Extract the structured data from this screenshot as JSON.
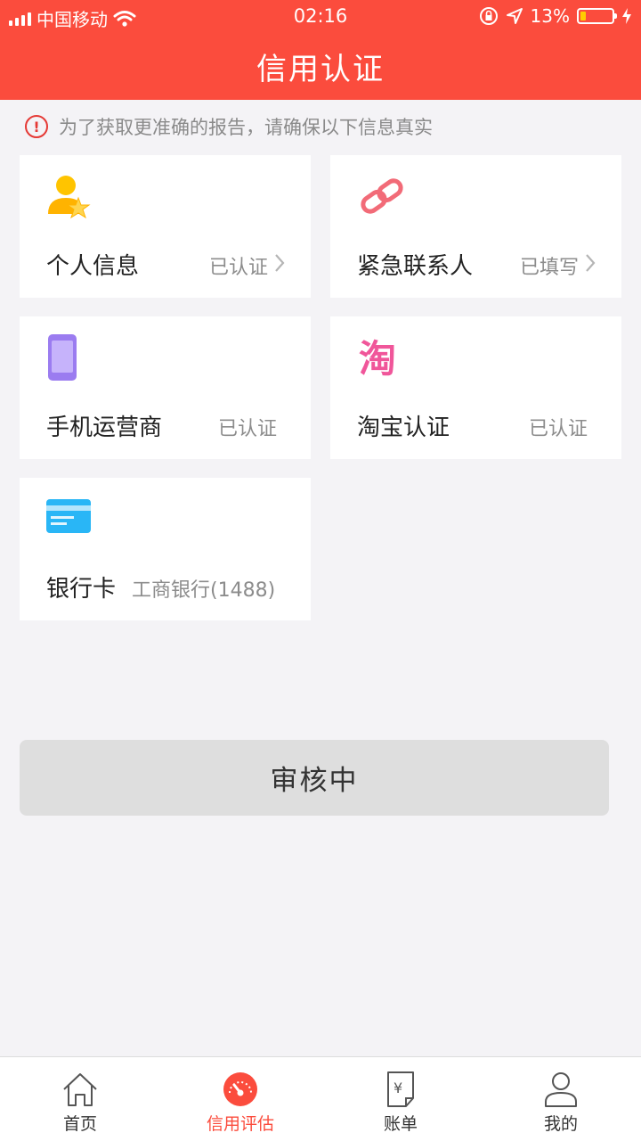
{
  "status_bar": {
    "carrier": "中国移动",
    "time": "02:16",
    "battery": "13%"
  },
  "header": {
    "title": "信用认证"
  },
  "notice": {
    "text": "为了获取更准确的报告，请确保以下信息真实"
  },
  "cards": {
    "personal": {
      "name": "个人信息",
      "status": "已认证",
      "icon": "user-star-icon"
    },
    "emergency": {
      "name": "紧急联系人",
      "status": "已填写",
      "icon": "link-icon"
    },
    "mobile": {
      "name": "手机运营商",
      "status": "已认证",
      "icon": "phone-icon"
    },
    "taobao": {
      "name": "淘宝认证",
      "status": "已认证",
      "icon": "taobao-icon"
    },
    "bank": {
      "name": "银行卡",
      "detail": "工商银行(1488)",
      "icon": "bank-card-icon"
    }
  },
  "button": {
    "label": "审核中"
  },
  "tabbar": {
    "tabs": [
      {
        "label": "首页",
        "icon": "home-icon"
      },
      {
        "label": "信用评估",
        "icon": "gauge-icon"
      },
      {
        "label": "账单",
        "icon": "bill-icon"
      },
      {
        "label": "我的",
        "icon": "person-icon"
      }
    ],
    "active_index": 1
  },
  "colors": {
    "brand": "#fb4c3d",
    "background": "#f4f3f6",
    "button_disabled": "#dedede"
  }
}
